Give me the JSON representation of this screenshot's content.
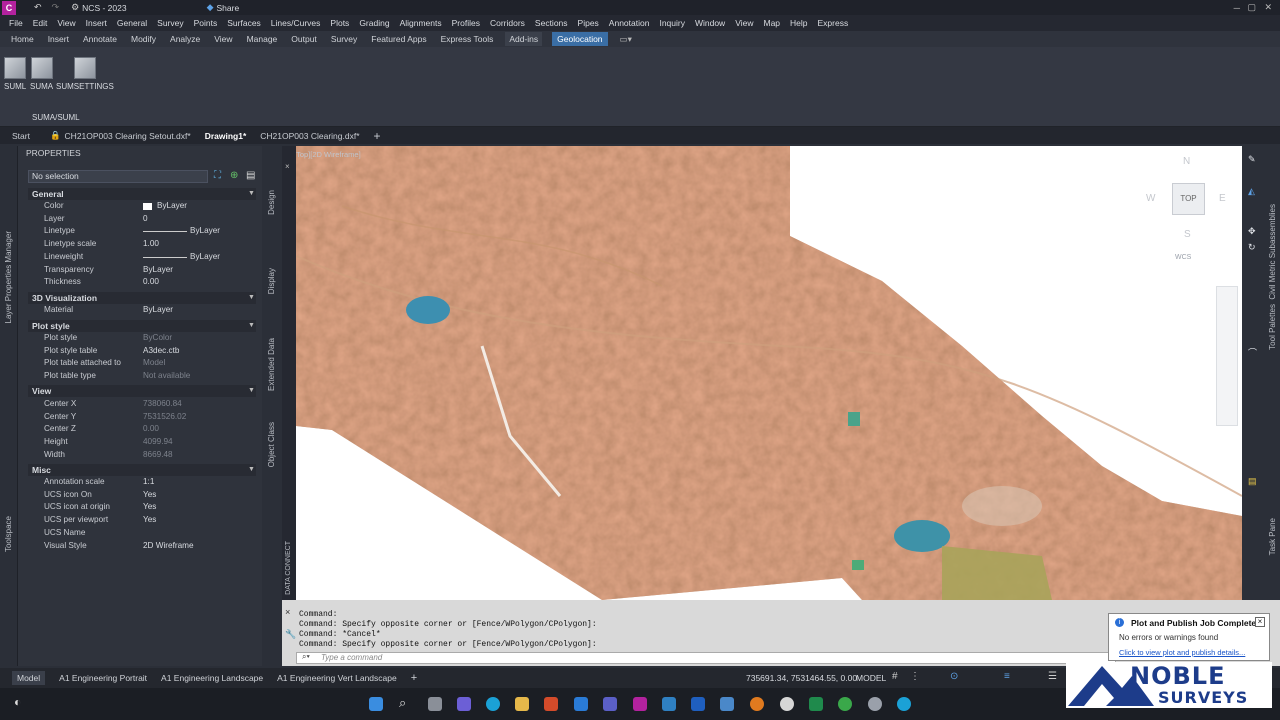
{
  "app": {
    "title": "NCS - 2023",
    "share": "Share",
    "logo_text": "C C3D"
  },
  "menus": [
    "File",
    "Edit",
    "View",
    "Insert",
    "General",
    "Survey",
    "Points",
    "Surfaces",
    "Lines/Curves",
    "Plots",
    "Grading",
    "Alignments",
    "Profiles",
    "Corridors",
    "Sections",
    "Pipes",
    "Annotation",
    "Inquiry",
    "Window",
    "View",
    "Map",
    "Help",
    "Express"
  ],
  "ribbon_tabs": [
    "Home",
    "Insert",
    "Annotate",
    "Modify",
    "Analyze",
    "View",
    "Manage",
    "Output",
    "Survey",
    "Featured Apps",
    "Express Tools",
    "Add-ins",
    "Geolocation"
  ],
  "ribbon": {
    "btn1": "SUML",
    "btn2": "SUMA",
    "btn3": "SUMSETTINGS",
    "panel": "SUMA/SUML"
  },
  "doc_tabs": {
    "start": "Start",
    "t1": "CH21OP003 Clearing Setout.dxf*",
    "t2": "Drawing1*",
    "t3": "CH21OP003 Clearing.dxf*"
  },
  "props": {
    "title": "PROPERTIES",
    "selection": "No selection",
    "general": "General",
    "g": [
      [
        "Color",
        "ByLayer"
      ],
      [
        "Layer",
        "0"
      ],
      [
        "Linetype",
        "ByLayer"
      ],
      [
        "Linetype scale",
        "1.00"
      ],
      [
        "Lineweight",
        "ByLayer"
      ],
      [
        "Transparency",
        "ByLayer"
      ],
      [
        "Thickness",
        "0.00"
      ]
    ],
    "viz": "3D Visualization",
    "v": [
      [
        "Material",
        "ByLayer"
      ]
    ],
    "plot": "Plot style",
    "p": [
      [
        "Plot style",
        "ByColor"
      ],
      [
        "Plot style table",
        "A3dec.ctb"
      ],
      [
        "Plot table attached to",
        "Model"
      ],
      [
        "Plot table type",
        "Not available"
      ]
    ],
    "view": "View",
    "w": [
      [
        "Center X",
        "738060.84"
      ],
      [
        "Center Y",
        "7531526.02"
      ],
      [
        "Center Z",
        "0.00"
      ],
      [
        "Height",
        "4099.94"
      ],
      [
        "Width",
        "8669.48"
      ]
    ],
    "misc": "Misc",
    "m": [
      [
        "Annotation scale",
        "1:1"
      ],
      [
        "UCS icon On",
        "Yes"
      ],
      [
        "UCS icon at origin",
        "Yes"
      ],
      [
        "UCS per viewport",
        "Yes"
      ],
      [
        "UCS Name",
        ""
      ],
      [
        "Visual Style",
        "2D Wireframe"
      ]
    ]
  },
  "side_left": {
    "layer": "Layer Properties Manager",
    "toolspace": "Toolspace"
  },
  "side_mid": {
    "design": "Design",
    "display": "Display",
    "extended": "Extended Data",
    "objclass": "Object Class"
  },
  "side_right": {
    "civil": "Civil Metric Subassemblies",
    "tool": "Tool Palettes",
    "task": "Task Pane"
  },
  "viewport": {
    "label": "[Top][2D Wireframe]",
    "data_connect": "DATA CONNECT",
    "n": "N",
    "s": "S",
    "e": "E",
    "w": "W",
    "top": "TOP",
    "wcs": "WCS"
  },
  "command": {
    "lines": [
      "Command:",
      "Command: Specify opposite corner or [Fence/WPolygon/CPolygon]:",
      "Command: *Cancel*",
      "Command: Specify opposite corner or [Fence/WPolygon/CPolygon]:"
    ],
    "placeholder": "Type a command"
  },
  "status": {
    "tabs": [
      "Model",
      "A1 Engineering Portrait",
      "A1 Engineering Landscape",
      "A1 Engineering Vert Landscape"
    ],
    "coords": "735691.34, 7531464.55, 0.00",
    "mode": "MODEL"
  },
  "toast": {
    "title": "Plot and Publish Job Complete",
    "msg": "No errors or warnings found",
    "link": "Click to view plot and publish details..."
  },
  "watermark": {
    "line1": "NOBLE",
    "line2": "SURVEYS"
  }
}
